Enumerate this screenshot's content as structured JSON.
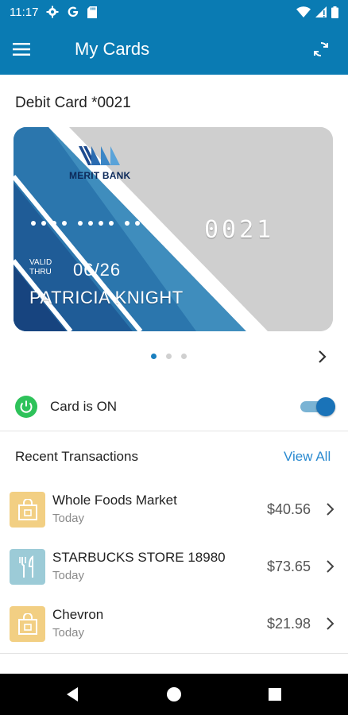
{
  "status_bar": {
    "time": "11:17",
    "left_icons": [
      "gear-icon",
      "google-icon",
      "sd-card-icon"
    ],
    "right_icons": [
      "wifi-icon",
      "signal-icon",
      "battery-icon"
    ]
  },
  "app_bar": {
    "title": "My Cards",
    "menu_icon": "hamburger-menu-icon",
    "refresh_icon": "refresh-icon",
    "color": "#0a7bb3"
  },
  "card_section": {
    "title": "Debit Card *0021",
    "card": {
      "bank_name": "MERIT BANK",
      "last4": "0021",
      "valid_thru_label": "VALID THRU",
      "expiry": "06/26",
      "holder": "PATRICIA KNIGHT"
    },
    "pager": {
      "total": 3,
      "active": 0
    }
  },
  "card_status": {
    "label": "Card is ON",
    "enabled": true,
    "icon": "power-icon",
    "icon_color": "#2ec25a"
  },
  "transactions": {
    "title": "Recent Transactions",
    "view_all": "View All",
    "items": [
      {
        "name": "Whole Foods Market",
        "date": "Today",
        "amount": "$40.56",
        "icon": "shopping-bag-icon",
        "icon_bg": "#f2cf83"
      },
      {
        "name": "STARBUCKS STORE 18980",
        "date": "Today",
        "amount": "$73.65",
        "icon": "fork-knife-icon",
        "icon_bg": "#9ccbd7"
      },
      {
        "name": "Chevron",
        "date": "Today",
        "amount": "$21.98",
        "icon": "shopping-bag-icon",
        "icon_bg": "#f2cf83"
      }
    ]
  },
  "nav_bar": {
    "buttons": [
      "back-icon",
      "home-icon",
      "recents-icon"
    ]
  }
}
